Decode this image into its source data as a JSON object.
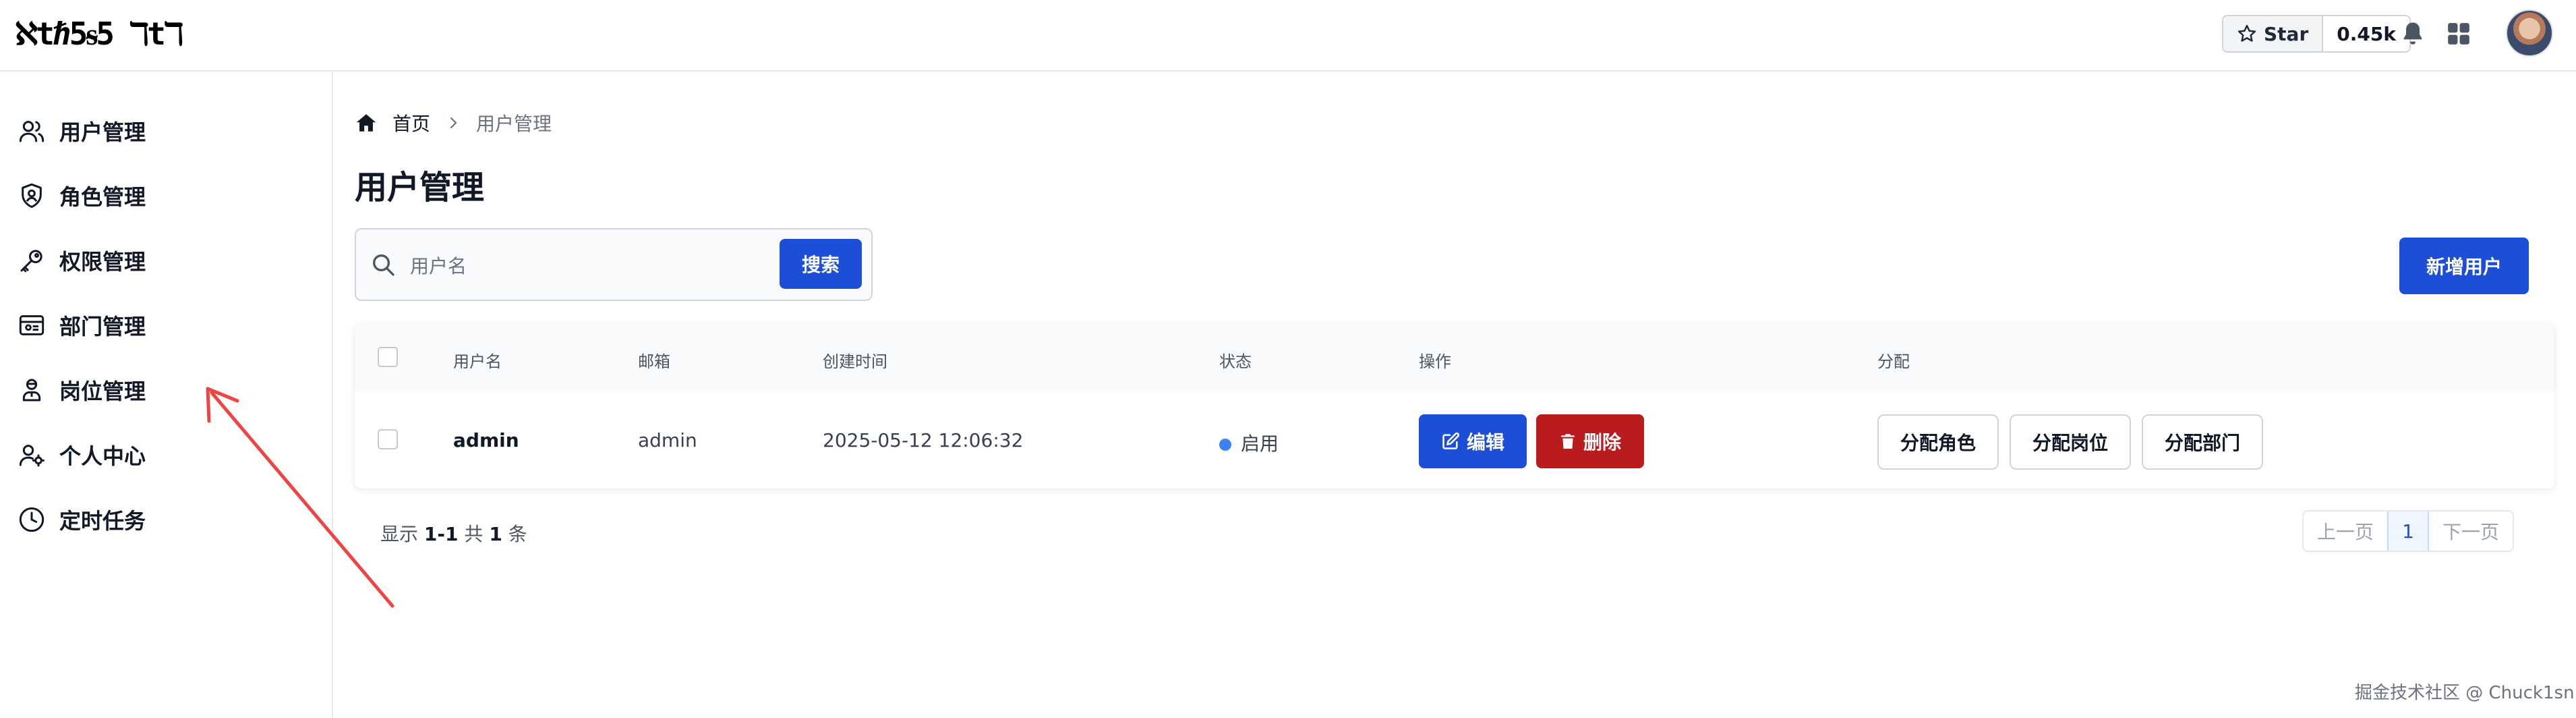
{
  "header": {
    "logo_text": "ℵtℏ5ᵴ5 ℸtℸ",
    "star_label": "Star",
    "star_count": "0.45k"
  },
  "sidebar": {
    "items": [
      {
        "label": "用户管理",
        "icon": "users-icon"
      },
      {
        "label": "角色管理",
        "icon": "shield-user-icon"
      },
      {
        "label": "权限管理",
        "icon": "key-icon"
      },
      {
        "label": "部门管理",
        "icon": "department-icon"
      },
      {
        "label": "岗位管理",
        "icon": "position-icon"
      },
      {
        "label": "个人中心",
        "icon": "user-settings-icon"
      },
      {
        "label": "定时任务",
        "icon": "clock-icon"
      }
    ]
  },
  "breadcrumb": {
    "home": "首页",
    "current": "用户管理"
  },
  "page": {
    "title": "用户管理"
  },
  "search": {
    "placeholder": "用户名",
    "value": "",
    "button_label": "搜索"
  },
  "toolbar": {
    "add_user_label": "新增用户"
  },
  "table": {
    "headers": {
      "username": "用户名",
      "email": "邮箱",
      "created_at": "创建时间",
      "status": "状态",
      "actions": "操作",
      "assign": "分配"
    },
    "rows": [
      {
        "username": "admin",
        "email": "admin",
        "created_at": "2025-05-12 12:06:32",
        "status": "启用",
        "edit_label": "编辑",
        "delete_label": "删除",
        "assign_role_label": "分配角色",
        "assign_position_label": "分配岗位",
        "assign_department_label": "分配部门"
      }
    ]
  },
  "pagination": {
    "prefix": "显示",
    "range": "1-1",
    "total_prefix": "共",
    "total": "1",
    "suffix": "条",
    "prev_label": "上一页",
    "current_page": "1",
    "next_label": "下一页"
  },
  "watermark": "掘金技术社区 @ Chuck1sn",
  "colors": {
    "primary": "#1d4ed8",
    "danger": "#b91c1c",
    "status_active": "#3b82f6",
    "annotation_arrow": "#ef4444"
  }
}
